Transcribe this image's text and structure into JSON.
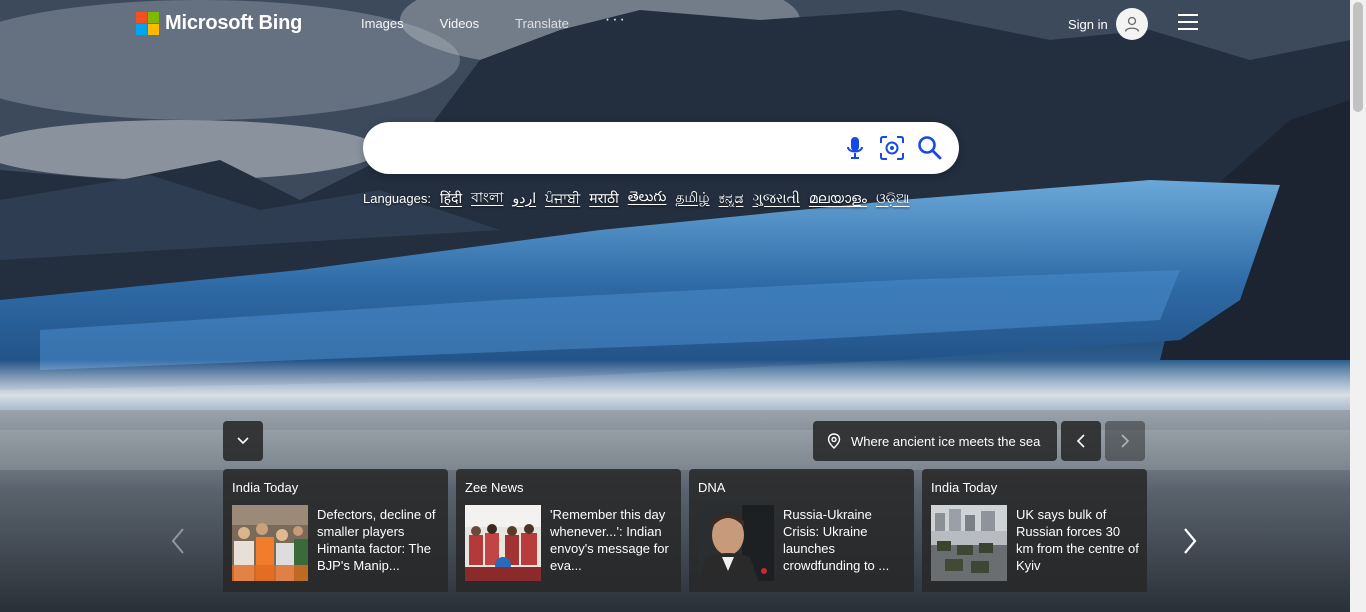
{
  "header": {
    "brand": "Microsoft Bing",
    "nav": [
      "Images",
      "Videos",
      "Translate"
    ],
    "more": "···",
    "signin": "Sign in"
  },
  "search": {
    "placeholder": "",
    "icons": [
      "microphone-icon",
      "visual-search-icon",
      "search-icon"
    ]
  },
  "languages": {
    "label": "Languages:",
    "items": [
      "हिंदी",
      "বাংলা",
      "اردو",
      "ਪੰਜਾਬੀ",
      "मराठी",
      "తెలుగు",
      "தமிழ்",
      "ಕನ್ನಡ",
      "ગુજરાતી",
      "മലയാളം",
      "ଓଡ଼ିଆ"
    ]
  },
  "image_caption": "Where ancient ice meets the sea",
  "news": [
    {
      "source": "India Today",
      "headline": "Defectors, decline of smaller players Himanta factor: The BJP's Manip..."
    },
    {
      "source": "Zee News",
      "headline": "'Remember this day whenever...': Indian envoy's message for eva..."
    },
    {
      "source": "DNA",
      "headline": "Russia-Ukraine Crisis: Ukraine launches crowdfunding to ..."
    },
    {
      "source": "India Today",
      "headline": "UK says bulk of Russian forces 30 km from the centre of Kyiv"
    }
  ],
  "colors": {
    "card_bg": "#282828",
    "accent_ms_red": "#f25022",
    "accent_ms_green": "#7fba00",
    "accent_ms_blue": "#00a4ef",
    "accent_ms_yellow": "#ffb900"
  }
}
